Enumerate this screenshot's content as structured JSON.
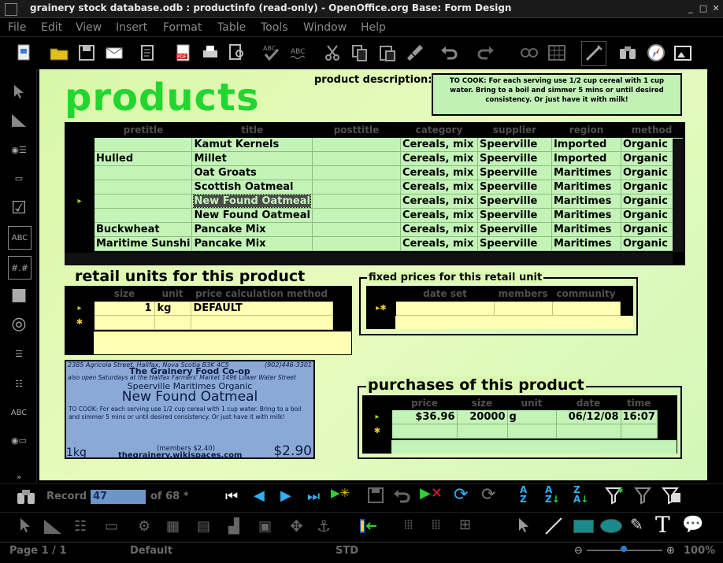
{
  "window": {
    "title": "grainery stock database.odb : productinfo (read-only) - OpenOffice.org Base: Form Design"
  },
  "menu": [
    "File",
    "Edit",
    "View",
    "Insert",
    "Format",
    "Table",
    "Tools",
    "Window",
    "Help"
  ],
  "form": {
    "title": "products",
    "description_label": "product description:",
    "description": "TO COOK: For each serving use 1/2 cup cereal with 1 cup water. Bring to a boil and simmer 5 mins or until desired consistency. Or just have it with milk!"
  },
  "products_grid": {
    "columns": [
      "pretitle",
      "title",
      "posttitle",
      "category",
      "supplier",
      "region",
      "method"
    ],
    "rows": [
      [
        "",
        "Kamut Kernels",
        "",
        "Cereals, mix",
        "Speerville",
        "Imported",
        "Organic"
      ],
      [
        "Hulled",
        "Millet",
        "",
        "Cereals, mix",
        "Speerville",
        "Imported",
        "Organic"
      ],
      [
        "",
        "Oat Groats",
        "",
        "Cereals, mix",
        "Speerville",
        "Maritimes",
        "Organic"
      ],
      [
        "",
        "Scottish Oatmeal",
        "",
        "Cereals, mix",
        "Speerville",
        "Maritimes",
        "Organic"
      ],
      [
        "",
        "New Found Oatmeal",
        "",
        "Cereals, mix",
        "Speerville",
        "Maritimes",
        "Organic"
      ],
      [
        "",
        "New Found Oatmeal",
        "",
        "Cereals, mix",
        "Speerville",
        "Maritimes",
        "Organic"
      ],
      [
        "Buckwheat",
        "Pancake Mix",
        "",
        "Cereals, mix",
        "Speerville",
        "Maritimes",
        "Organic"
      ],
      [
        "Maritime Sunshi",
        "Pancake Mix",
        "",
        "Cereals, mix",
        "Speerville",
        "Maritimes",
        "Organic"
      ]
    ]
  },
  "retail": {
    "title": "retail units for this product",
    "columns": [
      "size",
      "unit",
      "price calculation method"
    ],
    "rows": [
      [
        "1",
        "kg",
        "DEFAULT"
      ]
    ]
  },
  "fixed_prices": {
    "title": "fixed prices for this retail unit",
    "columns": [
      "date set",
      "members",
      "community"
    ]
  },
  "purchases": {
    "title": "purchases of this product",
    "columns": [
      "price",
      "size",
      "unit",
      "date",
      "time"
    ],
    "rows": [
      [
        "$36.96",
        "20000",
        "g",
        "06/12/08",
        "16:07"
      ]
    ]
  },
  "label_preview": {
    "address": "2385 Agricola Street, Halifax, Nova Scotia  B3K 4C5",
    "phone": "(902)446-3301",
    "store": "The Grainery Food Co-op",
    "hours": "also open Saturdays at the Halifax Farmers' Market 1496 Lower Water Street",
    "origin": "Speerville Maritimes Organic",
    "product": "New Found Oatmeal",
    "instructions": "TO COOK: For each serving use 1/2 cup cereal with 1 cup water. Bring to a boil and simmer 5 mins or until desired consistency. Or just have it with milk!",
    "members": "(members $2.40)",
    "size": "1kg",
    "website": "thegrainery.wikispaces.com",
    "price": "$2.90"
  },
  "navigation": {
    "record_label": "Record",
    "record_value": "47",
    "of_label": "of 68 *"
  },
  "status": {
    "page": "Page 1 / 1",
    "style": "Default",
    "mode": "STD",
    "zoom": "100%"
  },
  "colors": {
    "canvas": "#e0f9b4",
    "grid": "#c4f3b8",
    "title_green": "#22d630",
    "yellow": "#ffffb4"
  }
}
